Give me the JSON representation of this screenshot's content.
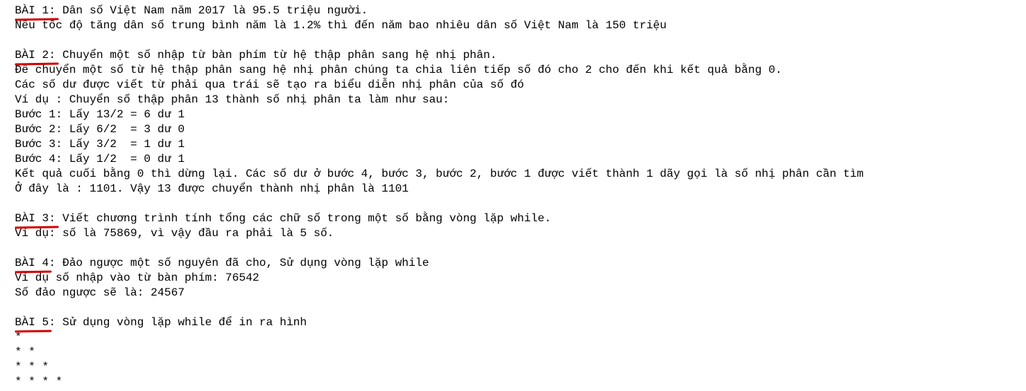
{
  "accent_color": "#d40000",
  "bai1": {
    "label": "BÀI 1:",
    "title": " Dân số Việt Nam năm 2017 là 95.5 triệu người.",
    "lines": [
      "Nếu tốc độ tăng dân số trung bình năm là 1.2% thì đến năm bao nhiêu dân số Việt Nam là 150 triệu"
    ]
  },
  "bai2": {
    "label": "BÀI 2:",
    "title": " Chuyển một số nhập từ bàn phím từ hệ thập phân sang hệ nhị phân.",
    "lines": [
      "Để chuyển một số từ hệ thập phân sang hệ nhị phân chúng ta chia liên tiếp số đó cho 2 cho đến khi kết quả bằng 0.",
      "Các số dư được viết từ phải qua trái sẽ tạo ra biểu diễn nhị phân của số đó",
      "Ví dụ : Chuyển số thập phân 13 thành số nhị phân ta làm như sau:",
      "Bước 1: Lấy 13/2 = 6 dư 1",
      "Bước 2: Lấy 6/2  = 3 dư 0",
      "Bước 3: Lấy 3/2  = 1 dư 1",
      "Bước 4: Lấy 1/2  = 0 dư 1",
      "Kết quả cuối bằng 0 thì dừng lại. Các số dư ở bước 4, bước 3, bước 2, bước 1 được viết thành 1 dãy gọi là số nhị phân cần tìm",
      "Ở đây là : 1101. Vậy 13 được chuyển thành nhị phân là 1101"
    ]
  },
  "bai3": {
    "label": "BÀI 3:",
    "title": " Viết chương trình tính tổng các chữ số trong một số bằng vòng lặp while.",
    "lines": [
      "Ví dụ: số là 75869, vì vậy đầu ra phải là 5 số."
    ]
  },
  "bai4": {
    "label": "BÀI 4",
    "title": ": Đảo ngược một số nguyên đã cho, Sử dụng vòng lặp while",
    "lines": [
      "Ví dụ số nhập vào từ bàn phím: 76542",
      "Số đảo ngược sẽ là: 24567"
    ]
  },
  "bai5": {
    "label": "BÀI 5",
    "title": ": Sử dụng vòng lặp while để in ra hình",
    "lines": [
      "*",
      "* *",
      "* * *",
      "* * * *"
    ]
  }
}
